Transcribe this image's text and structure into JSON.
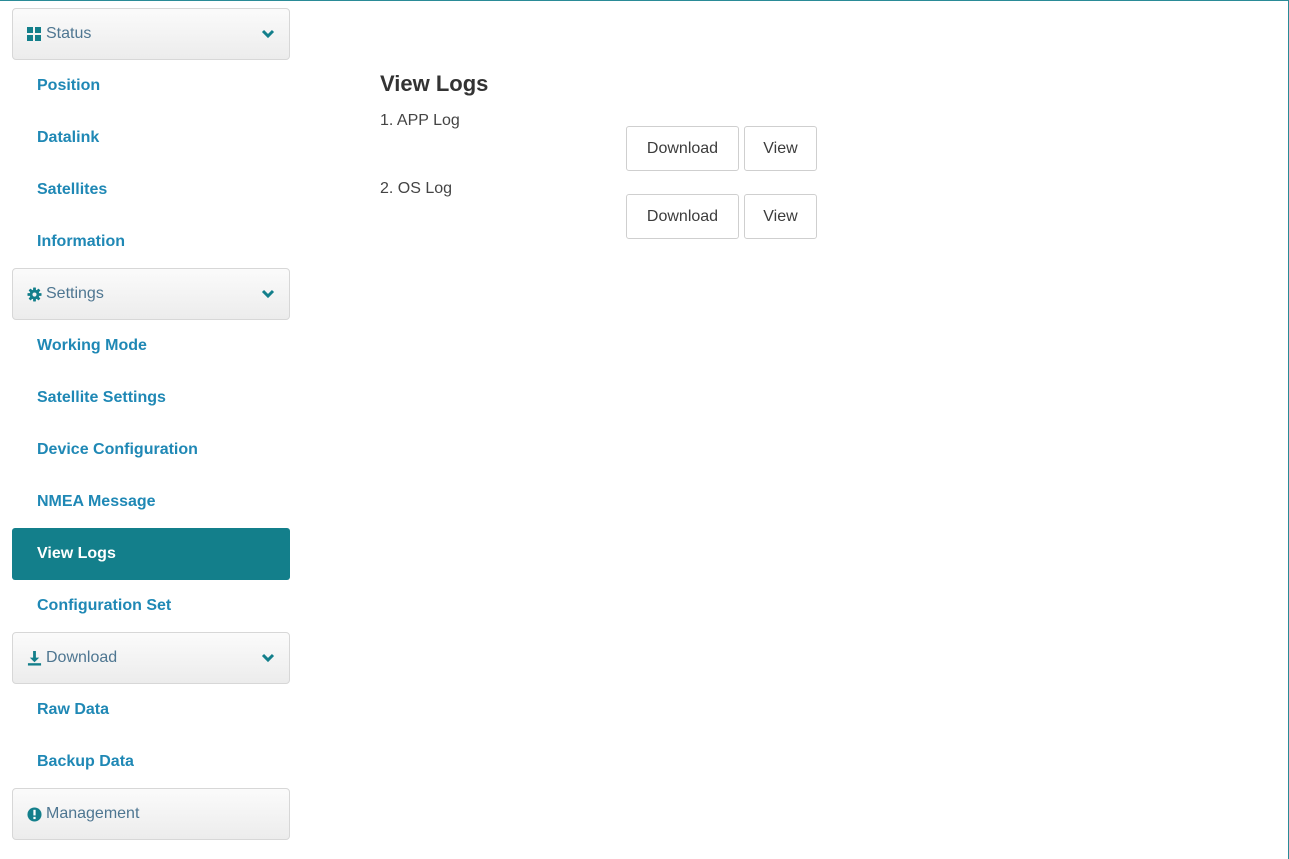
{
  "sidebar": {
    "status": {
      "label": "Status",
      "icon": "grid-icon",
      "items": [
        "Position",
        "Datalink",
        "Satellites",
        "Information"
      ]
    },
    "settings": {
      "label": "Settings",
      "icon": "gear-icon",
      "items": [
        "Working Mode",
        "Satellite Settings",
        "Device Configuration",
        "NMEA Message",
        "View Logs",
        "Configuration Set"
      ]
    },
    "download": {
      "label": "Download",
      "icon": "download-icon",
      "items": [
        "Raw Data",
        "Backup Data"
      ]
    },
    "management": {
      "label": "Management",
      "icon": "info-circle-icon"
    },
    "active_item": "View Logs"
  },
  "main": {
    "title": "View Logs",
    "logs": [
      {
        "label": "1. APP Log",
        "download_label": "Download",
        "view_label": "View"
      },
      {
        "label": "2. OS Log",
        "download_label": "Download",
        "view_label": "View"
      }
    ]
  },
  "colors": {
    "accent": "#137f8b",
    "link": "#1f88b5",
    "header_text": "#4e7691"
  }
}
